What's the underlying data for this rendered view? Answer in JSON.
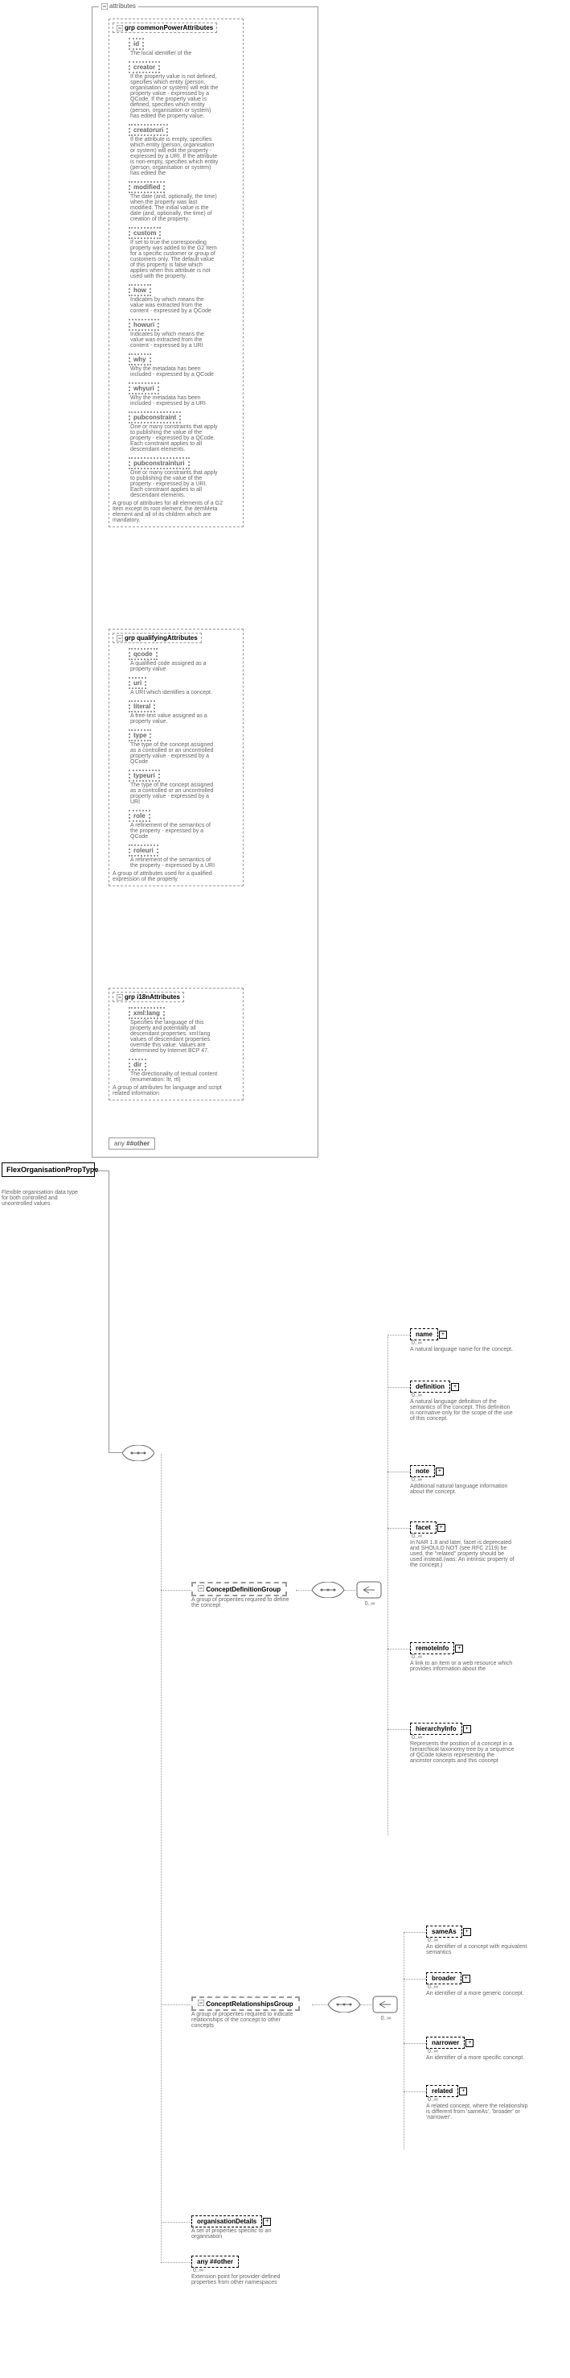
{
  "root": {
    "name": "FlexOrganisationPropType",
    "desc": "Flexible organisation data type for both controlled and uncontrolled values"
  },
  "attrbox_label": "attributes",
  "groups": {
    "common": {
      "title": "commonPowerAttributes",
      "desc": "A group of attributes for all elements of a G2 Item except its root element, the itemMeta element and all of its children which are mandatory.",
      "attrs": [
        {
          "name": "id",
          "desc": "The local identifier of the"
        },
        {
          "name": "creator",
          "desc": "If the property value is not defined, specifies which entity (person, organisation or system) will edit the property value - expressed by a QCode. If the property value is defined, specifies which entity (person, organisation or system) has edited the property value."
        },
        {
          "name": "creatoruri",
          "desc": "If the attribute is empty, specifies which entity (person, organisation or system) will edit the property - expressed by a URI. If the attribute is non-empty, specifies which entity (person, organisation or system) has edited the"
        },
        {
          "name": "modified",
          "desc": "The date (and, optionally, the time) when the property was last modified. The initial value is the date (and, optionally, the time) of creation of the property."
        },
        {
          "name": "custom",
          "desc": "If set to true the corresponding property was added to the G2 Item for a specific customer or group of customers only. The default value of this property is false which applies when this attribute is not used with the property."
        },
        {
          "name": "how",
          "desc": "Indicates by which means the value was extracted from the content - expressed by a QCode"
        },
        {
          "name": "howuri",
          "desc": "Indicates by which means the value was extracted from the content - expressed by a URI"
        },
        {
          "name": "why",
          "desc": "Why the metadata has been included - expressed by a QCode"
        },
        {
          "name": "whyuri",
          "desc": "Why the metadata has been included - expressed by a URI"
        },
        {
          "name": "pubconstraint",
          "desc": "One or many constraints that apply to publishing the value of the property - expressed by a QCode. Each constraint applies to all descendant elements."
        },
        {
          "name": "pubconstrainturi",
          "desc": "One or many constraints that apply to publishing the value of the property - expressed by a URI. Each constraint applies to all descendant elements."
        }
      ]
    },
    "qual": {
      "title": "qualifyingAttributes",
      "desc": "A group of attributes used for a qualified expression of the property",
      "attrs": [
        {
          "name": "qcode",
          "desc": "A qualified code assigned as a property value."
        },
        {
          "name": "uri",
          "desc": "A URI which identifies a concept."
        },
        {
          "name": "literal",
          "desc": "A free-text value assigned as a property value."
        },
        {
          "name": "type",
          "desc": "The type of the concept assigned as a controlled or an uncontrolled property value - expressed by a QCode"
        },
        {
          "name": "typeuri",
          "desc": "The type of the concept assigned as a controlled or an uncontrolled property value - expressed by a URI"
        },
        {
          "name": "role",
          "desc": "A refinement of the semantics of the property - expressed by a QCode"
        },
        {
          "name": "roleuri",
          "desc": "A refinement of the semantics of the property - expressed by a URI"
        }
      ]
    },
    "i18n": {
      "title": "i18nAttributes",
      "desc": "A group of attributes for language and script related information",
      "attrs": [
        {
          "name": "xml:lang",
          "desc": "Specifies the language of this property and potentially all descendant properties. xml:lang values of descendant properties override this value. Values are determined by Internet BCP 47."
        },
        {
          "name": "dir",
          "desc": "The directionality of textual content (enumeration: ltr, rtl)"
        }
      ]
    }
  },
  "wildcard_attr": "##other",
  "concept_def": {
    "title": "ConceptDefinitionGroup",
    "desc": "A group of properites required to define the concept",
    "children": [
      {
        "name": "name",
        "desc": "A natural language name for the concept."
      },
      {
        "name": "definition",
        "desc": "A natural language definition of the semantics of the concept. This definition is normative only for the scope of the use of this concept."
      },
      {
        "name": "note",
        "desc": "Additional natural language information about the concept."
      },
      {
        "name": "facet",
        "desc": "In NAR 1.8 and later, facet is deprecated and SHOULD NOT (see RFC 2119) be used, the \"related\" property should be used instead.(was: An intrinsic property of the concept.)"
      },
      {
        "name": "remoteInfo",
        "desc": "A link to an item or a web resource which provides information about the"
      },
      {
        "name": "hierarchyInfo",
        "desc": "Represents the position of a concept in a hierarchical taxonomy tree by a sequence of QCode tokens representing the ancestor concepts and this concept"
      }
    ]
  },
  "concept_rel": {
    "title": "ConceptRelationshipsGroup",
    "desc": "A group of properites required to indicate relationships of the concept to other concepts",
    "children": [
      {
        "name": "sameAs",
        "desc": "An identifier of a concept with equivalent semantics"
      },
      {
        "name": "broader",
        "desc": "An identifier of a more generic concept."
      },
      {
        "name": "narrower",
        "desc": "An identifier of a more specific concept."
      },
      {
        "name": "related",
        "desc": "A related concept, where the relationship is different from 'sameAs', 'broader' or 'narrower'."
      }
    ]
  },
  "org_details": {
    "name": "organisationDetails",
    "desc": "A set of properties specific to an organisation"
  },
  "wildcard_elem": {
    "name": "##other",
    "desc": "Extension point for provider-defined properties from other namespaces"
  },
  "occ_many": "0..∞",
  "any_label": "any"
}
